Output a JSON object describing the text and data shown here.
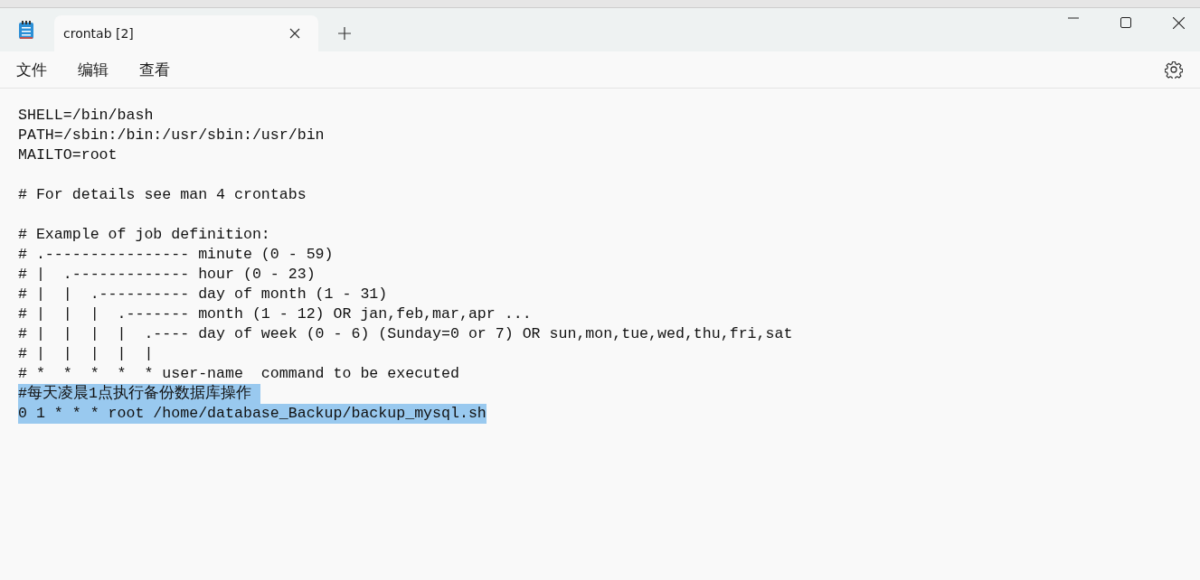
{
  "window": {
    "tab_title": "crontab [2]"
  },
  "menu": [
    "文件",
    "编辑",
    "查看"
  ],
  "lines": [
    {
      "kind": "text",
      "text": "SHELL=/bin/bash",
      "selected": false
    },
    {
      "kind": "text",
      "text": "PATH=/sbin:/bin:/usr/sbin:/usr/bin",
      "selected": false
    },
    {
      "kind": "text",
      "text": "MAILTO=root",
      "selected": false
    },
    {
      "kind": "blank"
    },
    {
      "kind": "text",
      "text": "# For details see man 4 crontabs",
      "selected": false
    },
    {
      "kind": "blank"
    },
    {
      "kind": "text",
      "text": "# Example of job definition:",
      "selected": false
    },
    {
      "kind": "text",
      "text": "# .---------------- minute (0 - 59)",
      "selected": false
    },
    {
      "kind": "text",
      "text": "# |  .------------- hour (0 - 23)",
      "selected": false
    },
    {
      "kind": "text",
      "text": "# |  |  .---------- day of month (1 - 31)",
      "selected": false
    },
    {
      "kind": "text",
      "text": "# |  |  |  .------- month (1 - 12) OR jan,feb,mar,apr ...",
      "selected": false
    },
    {
      "kind": "text",
      "text": "# |  |  |  |  .---- day of week (0 - 6) (Sunday=0 or 7) OR sun,mon,tue,wed,thu,fri,sat",
      "selected": false
    },
    {
      "kind": "text",
      "text": "# |  |  |  |  |",
      "selected": false
    },
    {
      "kind": "text",
      "text": "# *  *  *  *  * user-name  command to be executed",
      "selected": false
    },
    {
      "kind": "text",
      "text": "#每天凌晨1点执行备份数据库操作 ",
      "selected": true
    },
    {
      "kind": "text",
      "text": "0 1 * * * root /home/database_Backup/backup_mysql.sh",
      "selected": true
    }
  ]
}
